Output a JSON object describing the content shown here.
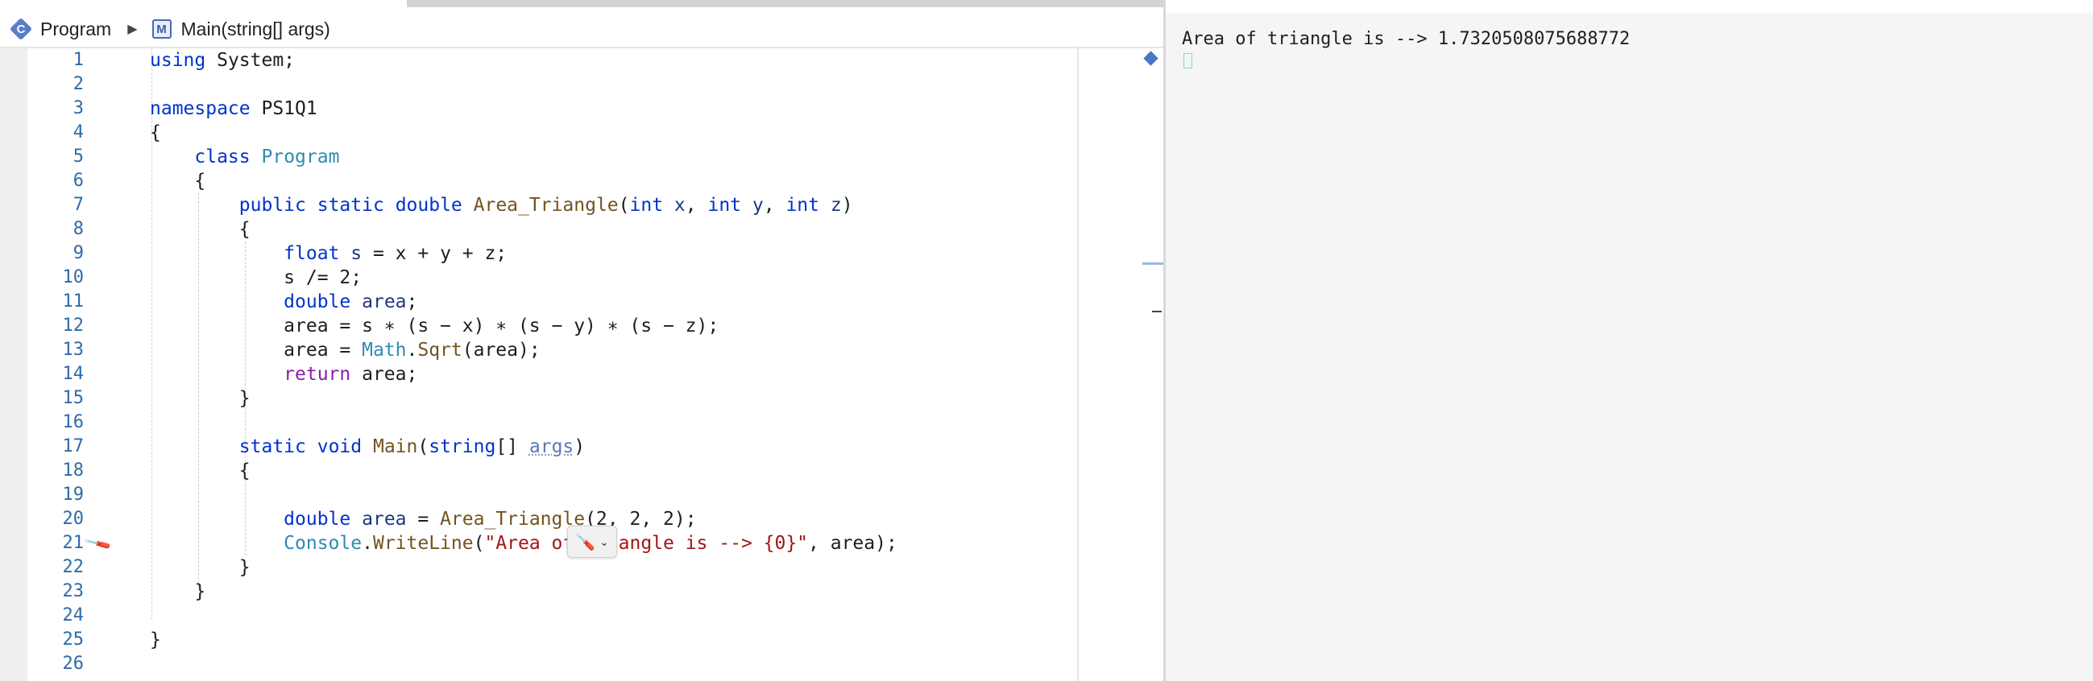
{
  "breadcrumb": {
    "class_icon_letter": "C",
    "class_name": "Program",
    "separator": "▶",
    "method_icon_letter": "M",
    "method_name": "Main(string[] args)"
  },
  "icons": {
    "class": "class-icon",
    "separator": "chevron-right-icon",
    "method": "method-icon",
    "quick_actions": "screwdriver-icon",
    "quick_actions_dropdown": "chevron-down-icon",
    "bookmark": "bookmark-diamond-icon"
  },
  "editor": {
    "line_numbers": [
      "1",
      "2",
      "3",
      "4",
      "5",
      "6",
      "7",
      "8",
      "9",
      "10",
      "11",
      "12",
      "13",
      "14",
      "15",
      "16",
      "17",
      "18",
      "19",
      "20",
      "21",
      "22",
      "23",
      "24",
      "25",
      "26"
    ]
  },
  "quick_actions": {
    "glyph": "🪛",
    "chevron": "⌄"
  },
  "console": {
    "output": "Area of triangle is --> 1.7320508075688772"
  },
  "colors": {
    "keyword": "#0033cc",
    "control_keyword": "#8a1fa8",
    "type": "#2f8bb0",
    "method": "#74531f",
    "parameter": "#1f377f",
    "string": "#a31515",
    "line_number": "#2f6aa8"
  }
}
